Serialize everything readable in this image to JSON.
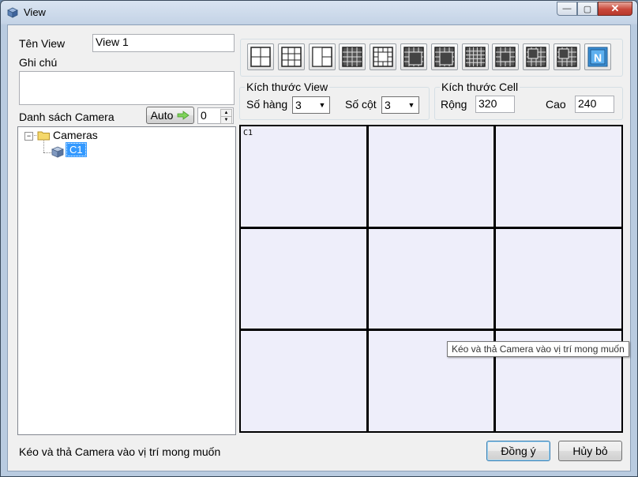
{
  "window": {
    "title": "View",
    "minimize": "—",
    "maximize": "▢",
    "close": "✕"
  },
  "form": {
    "view_name_label": "Tên View",
    "view_name_value": "View 1",
    "note_label": "Ghi chú",
    "note_value": "",
    "camera_list_label": "Danh sách Camera",
    "auto_button": "Auto",
    "auto_count": "0"
  },
  "tree": {
    "root": "Cameras",
    "children": [
      "C1"
    ]
  },
  "layout_buttons": [
    "layout-2x2",
    "layout-3x3",
    "layout-1plus3",
    "layout-4x4",
    "layout-1plus12",
    "layout-1plus5",
    "layout-1plus7",
    "layout-5x5",
    "layout-1plus16",
    "layout-1plus9",
    "layout-1plus11",
    "layout-custom-n"
  ],
  "view_size": {
    "legend": "Kích thước View",
    "rows_label": "Số hàng",
    "rows_value": "3",
    "cols_label": "Số cột",
    "cols_value": "3"
  },
  "cell_size": {
    "legend": "Kích thước Cell",
    "width_label": "Rộng",
    "width_value": "320",
    "height_label": "Cao",
    "height_value": "240"
  },
  "grid_cells": [
    "C1",
    "",
    "",
    "",
    "",
    "",
    "",
    "",
    ""
  ],
  "tooltip": "Kéo và thả Camera vào vị trí mong muốn",
  "status_text": "Kéo và thả Camera vào vị trí mong muốn",
  "buttons": {
    "ok": "Đồng ý",
    "cancel": "Hủy bỏ"
  },
  "colors": {
    "grid_cell": "#eeeefa",
    "selected": "#3399ff",
    "titlebar": "#c4d3e6"
  }
}
